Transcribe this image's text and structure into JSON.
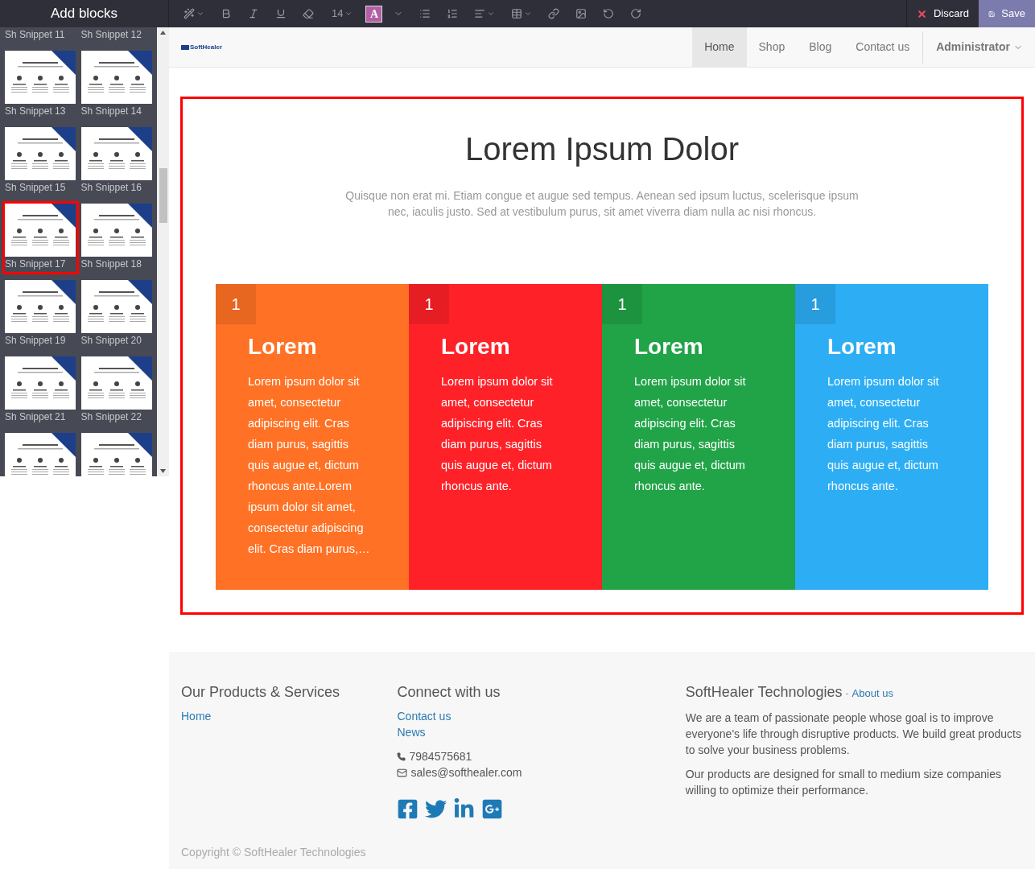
{
  "toolbar": {
    "title": "Add blocks",
    "font_size": "14",
    "color_letter": "A",
    "discard": "Discard",
    "save": "Save"
  },
  "snippets": [
    {
      "label": "Sh Snippet 11",
      "selected": false,
      "thumb": false
    },
    {
      "label": "Sh Snippet 12",
      "selected": false,
      "thumb": false
    },
    {
      "label": "Sh Snippet 13",
      "selected": false,
      "thumb": true
    },
    {
      "label": "Sh Snippet 14",
      "selected": false,
      "thumb": true
    },
    {
      "label": "Sh Snippet 15",
      "selected": false,
      "thumb": true
    },
    {
      "label": "Sh Snippet 16",
      "selected": false,
      "thumb": true
    },
    {
      "label": "Sh Snippet 17",
      "selected": true,
      "thumb": true
    },
    {
      "label": "Sh Snippet 18",
      "selected": false,
      "thumb": true
    },
    {
      "label": "Sh Snippet 19",
      "selected": false,
      "thumb": true
    },
    {
      "label": "Sh Snippet 20",
      "selected": false,
      "thumb": true
    },
    {
      "label": "Sh Snippet 21",
      "selected": false,
      "thumb": true
    },
    {
      "label": "Sh Snippet 22",
      "selected": false,
      "thumb": true
    },
    {
      "selected": false,
      "thumb": true
    },
    {
      "selected": false,
      "thumb": true
    }
  ],
  "nav": {
    "logo": "SoftHealer",
    "items": [
      {
        "label": "Home",
        "selected": true
      },
      {
        "label": "Shop",
        "selected": false
      },
      {
        "label": "Blog",
        "selected": false
      },
      {
        "label": "Contact us",
        "selected": false
      }
    ],
    "user": "Administrator"
  },
  "hero": {
    "title": "Lorem Ipsum Dolor",
    "subtitle": "Quisque non erat mi. Etiam congue et augue sed tempus. Aenean sed ipsum luctus, scelerisque ipsum nec, iaculis justo. Sed at vestibulum purus, sit amet viverra diam nulla ac nisi rhoncus."
  },
  "cards": [
    {
      "number": "1",
      "title": "Lorem",
      "text": "Lorem ipsum dolor sit amet, consectetur adipiscing elit. Cras diam purus, sagittis quis augue et, dictum rhoncus ante.Lorem ipsum dolor sit amet, consectetur adipiscing elit. Cras diam purus,…",
      "color": "#ff7124"
    },
    {
      "number": "1",
      "title": "Lorem",
      "text": "Lorem ipsum dolor sit amet, consectetur adipiscing elit. Cras diam purus, sagittis quis augue et, dictum rhoncus ante.",
      "color": "#ff2128"
    },
    {
      "number": "1",
      "title": "Lorem",
      "text": "Lorem ipsum dolor sit amet, consectetur adipiscing elit. Cras diam purus, sagittis quis augue et, dictum rhoncus ante.",
      "color": "#21a347"
    },
    {
      "number": "1",
      "title": "Lorem",
      "text": "Lorem ipsum dolor sit amet, consectetur adipiscing elit. Cras diam purus, sagittis quis augue et, dictum rhoncus ante.",
      "color": "#2daef4"
    }
  ],
  "footer": {
    "products": {
      "heading": "Our Products & Services",
      "links": [
        "Home"
      ]
    },
    "connect": {
      "heading": "Connect with us",
      "links": [
        "Contact us",
        "News"
      ],
      "phone": "7984575681",
      "email": "sales@softhealer.com"
    },
    "about": {
      "heading": "SoftHealer Technologies",
      "separator": "-",
      "link": "About us",
      "paragraphs": [
        "We are a team of passionate people whose goal is to improve everyone's life through disruptive products. We build great products to solve your business problems.",
        "Our products are designed for small to medium size companies willing to optimize their performance."
      ]
    },
    "copyright": "Copyright © SoftHealer Technologies"
  }
}
